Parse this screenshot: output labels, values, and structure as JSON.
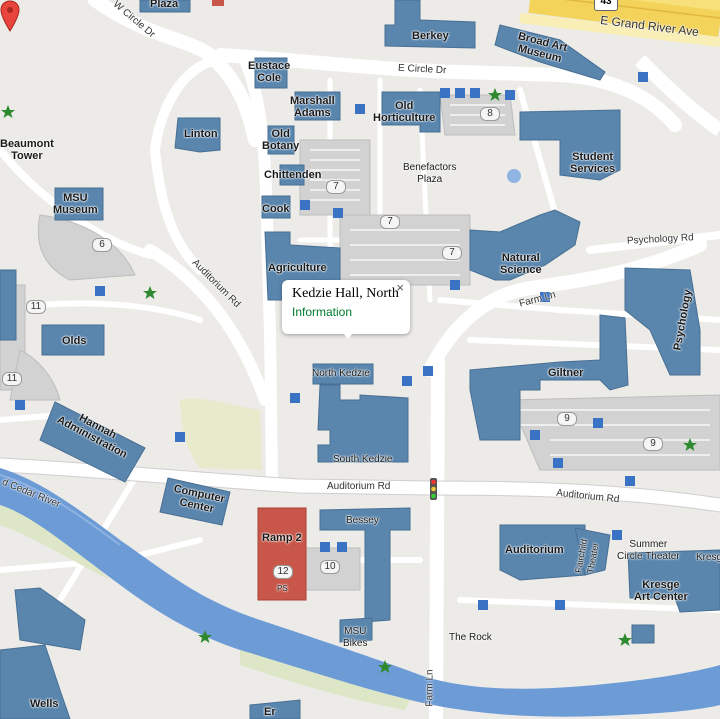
{
  "map": {
    "highway_shield": "43",
    "popup": {
      "title": "Kedzie Hall, North",
      "link": "Information",
      "close_symbol": "×"
    },
    "buildings": [
      {
        "name": "Plaza",
        "label": "Plaza"
      },
      {
        "name": "Berkey",
        "label": "Berkey"
      },
      {
        "name": "Broad Art Museum",
        "label": "Broad Art\nMuseum"
      },
      {
        "name": "Eustace Cole",
        "label": "Eustace\nCole"
      },
      {
        "name": "Marshall Adams",
        "label": "Marshall\nAdams"
      },
      {
        "name": "Old Horticulture",
        "label": "Old\nHorticulture"
      },
      {
        "name": "Linton",
        "label": "Linton"
      },
      {
        "name": "Old Botany",
        "label": "Old\nBotany"
      },
      {
        "name": "Chittenden",
        "label": "Chittenden"
      },
      {
        "name": "Cook",
        "label": "Cook"
      },
      {
        "name": "Beaumont Tower",
        "label": "Beaumont\nTower"
      },
      {
        "name": "MSU Museum",
        "label": "MSU\nMuseum"
      },
      {
        "name": "Student Services",
        "label": "Student\nServices"
      },
      {
        "name": "Natural Science",
        "label": "Natural\nScience"
      },
      {
        "name": "Agriculture",
        "label": "Agriculture"
      },
      {
        "name": "Psychology",
        "label": "Psychology"
      },
      {
        "name": "Olds",
        "label": "Olds"
      },
      {
        "name": "North Kedzie",
        "label": "North Kedzie"
      },
      {
        "name": "Giltner",
        "label": "Giltner"
      },
      {
        "name": "Hannah Administration",
        "label": "Hannah\nAdministration"
      },
      {
        "name": "South Kedzie",
        "label": "South Kedzie"
      },
      {
        "name": "Computer Center",
        "label": "Computer\nCenter"
      },
      {
        "name": "Ramp 2",
        "label": "Ramp 2"
      },
      {
        "name": "Bessey",
        "label": "Bessey"
      },
      {
        "name": "Auditorium",
        "label": "Auditorium"
      },
      {
        "name": "Fairchild Theater",
        "label": "Fairchild\nTheater"
      },
      {
        "name": "Summer Circle Theater",
        "label": "Summer\nCircle Theater"
      },
      {
        "name": "Kresge Art Center",
        "label": "Kresge\nArt Center"
      },
      {
        "name": "Kresge",
        "label": "Kresge"
      },
      {
        "name": "MSU Bikes",
        "label": "MSU\nBikes"
      },
      {
        "name": "The Rock",
        "label": "The Rock"
      },
      {
        "name": "Wells",
        "label": "Wells"
      },
      {
        "name": "Benefactors Plaza",
        "label": "Benefactors\nPlaza"
      },
      {
        "name": "Er",
        "label": "Er"
      }
    ],
    "roads": {
      "w_circle_dr": "W Circle Dr",
      "e_circle_dr": "E Circle Dr",
      "e_grand_river": "E Grand River Ave",
      "auditorium_rd_diag": "Auditorium Rd",
      "auditorium_rd": "Auditorium Rd",
      "auditorium_rd_east": "Auditorium Rd",
      "farm_ln": "Farm Ln",
      "farm_ln_south": "Farm Ln",
      "psychology_rd": "Psychology Rd",
      "red_cedar_river": "d Cedar River"
    },
    "lots": [
      "8",
      "7",
      "7",
      "7",
      "6",
      "11",
      "11",
      "9",
      "9",
      "12",
      "10"
    ],
    "ramp_sub": "PS"
  }
}
